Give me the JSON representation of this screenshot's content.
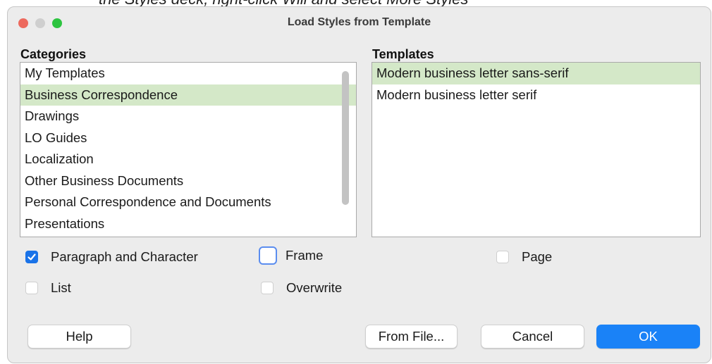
{
  "background_caption": "the Styles deck, right-click Will and select More Styles",
  "dialog": {
    "title": "Load Styles from Template",
    "accent_color": "#1a82f7",
    "selection_color": "#d4e8c8"
  },
  "categories": {
    "label": "Categories",
    "items": [
      "My Templates",
      "Business Correspondence",
      "Drawings",
      "LO Guides",
      "Localization",
      "Other Business Documents",
      "Personal Correspondence and Documents",
      "Presentations"
    ],
    "selected": "Business Correspondence"
  },
  "templates": {
    "label": "Templates",
    "items": [
      "Modern business letter sans-serif",
      "Modern business letter serif"
    ],
    "selected": "Modern business letter sans-serif"
  },
  "options": {
    "paragraph_and_character": {
      "label": "Paragraph and Character",
      "checked": true
    },
    "frame": {
      "label": "Frame",
      "checked": false
    },
    "page": {
      "label": "Page",
      "checked": false
    },
    "list": {
      "label": "List",
      "checked": false
    },
    "overwrite": {
      "label": "Overwrite",
      "checked": false
    }
  },
  "buttons": {
    "help": "Help",
    "from_file": "From File...",
    "cancel": "Cancel",
    "ok": "OK"
  }
}
